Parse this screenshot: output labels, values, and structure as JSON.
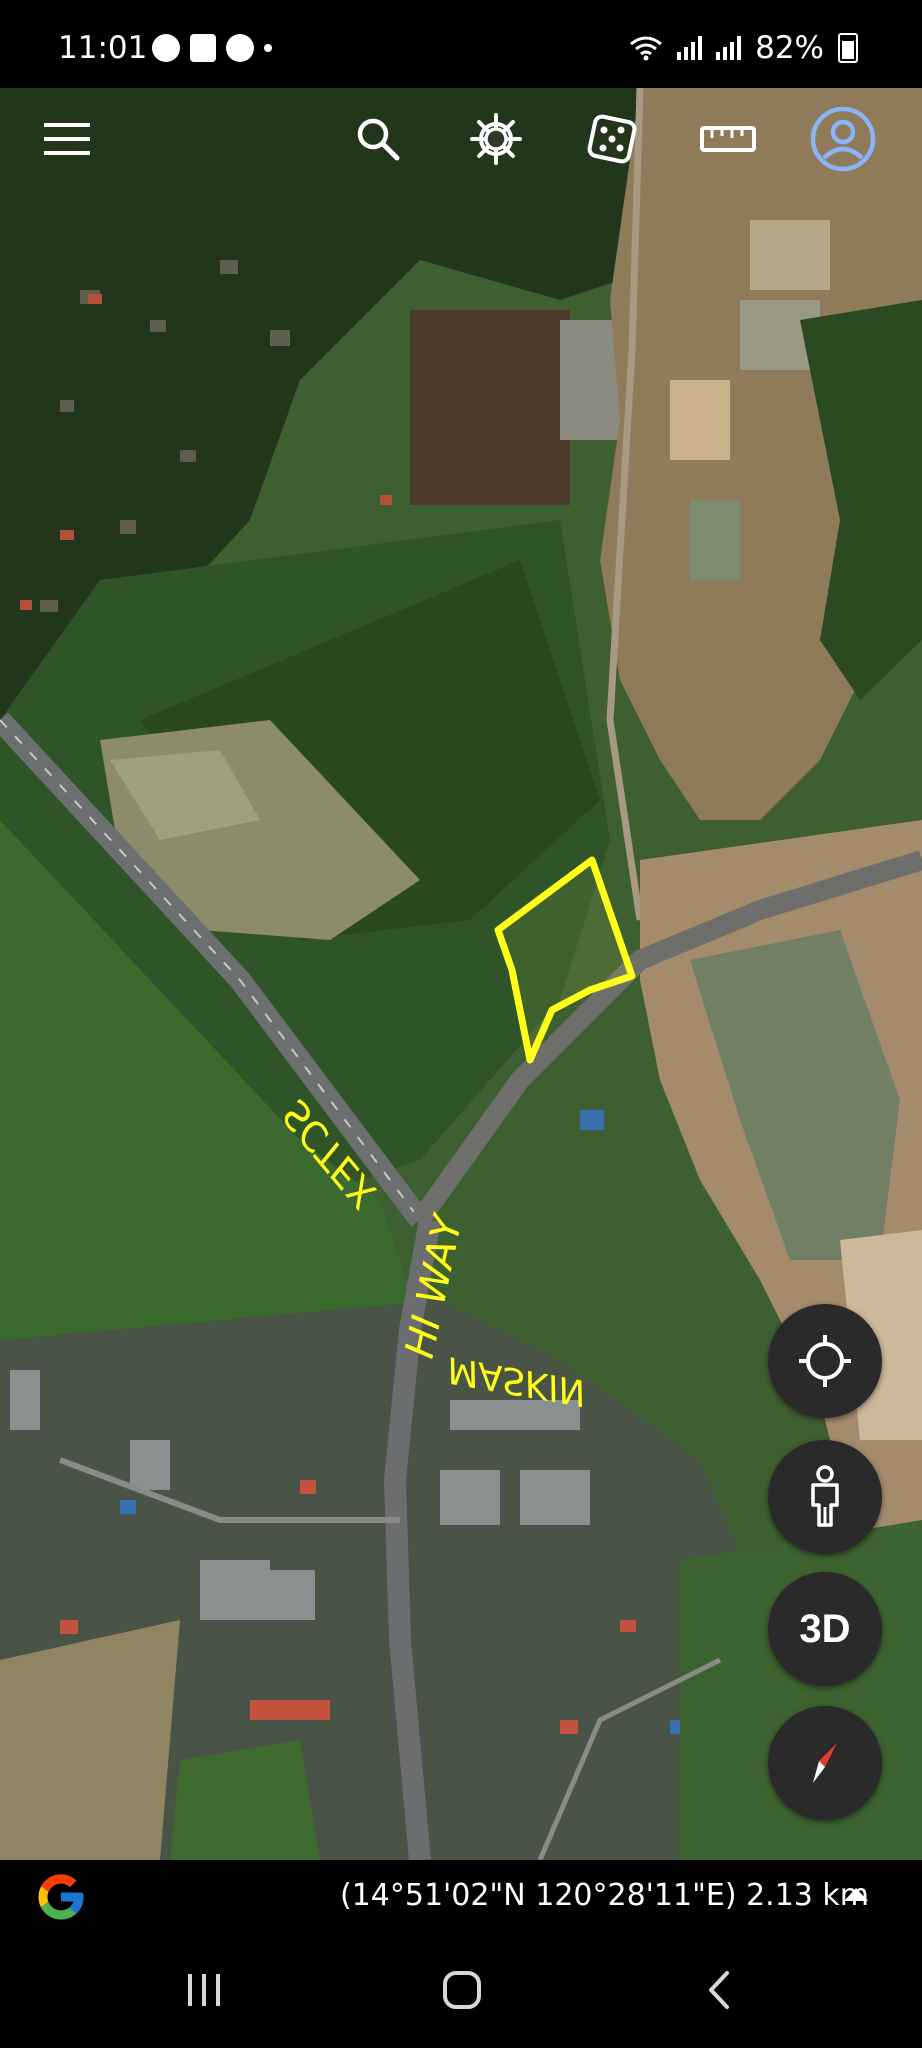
{
  "status_bar": {
    "time": "11:01",
    "battery": "82%",
    "notification_icons": [
      "messenger-icon",
      "shop-icon",
      "messenger-icon"
    ]
  },
  "toolbar": {
    "icons": [
      "menu-icon",
      "search-icon",
      "voyager-icon",
      "feeling-lucky-dice-icon",
      "measure-ruler-icon",
      "account-icon"
    ],
    "accent": "#8ab4f8"
  },
  "map": {
    "highlight_color": "#ffff1a",
    "annotations": [
      "SCTEX",
      "HI WAY",
      "MASKIN"
    ]
  },
  "controls": {
    "three_d_label": "3D",
    "icons": [
      "my-location-icon",
      "street-view-pegman-icon",
      "3d-toggle",
      "compass-icon"
    ]
  },
  "footer": {
    "coordinates": "(14°51'02\"N 120°28'11\"E) 2.13 km"
  },
  "nav_bar": {
    "icons": [
      "recent-apps-icon",
      "home-icon",
      "back-icon"
    ]
  }
}
